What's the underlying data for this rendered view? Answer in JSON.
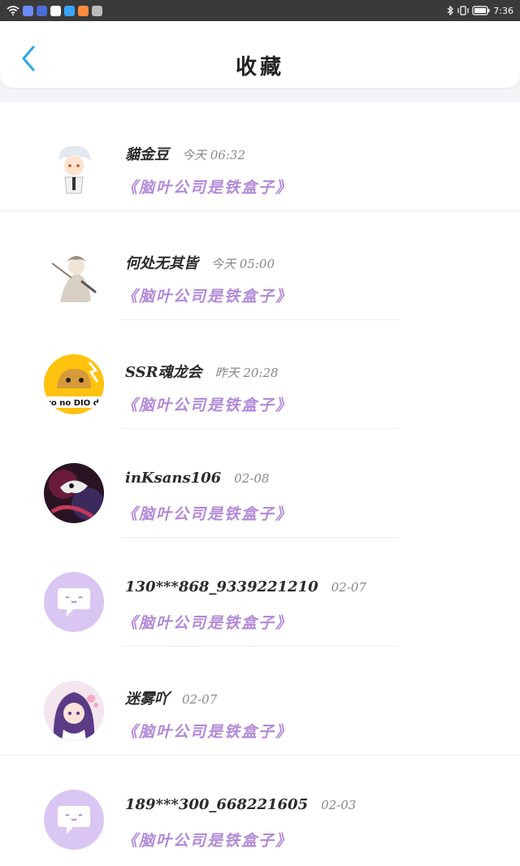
{
  "status_bar": {
    "time": "7:36",
    "app_colors": [
      "#6b8cff",
      "#4b6bd8",
      "#ffffff",
      "#3aa3ff",
      "#ff8a3d"
    ]
  },
  "header": {
    "title": "收藏",
    "back_icon": "chevron-left-icon",
    "accent": "#2aa7e8"
  },
  "favorites": [
    {
      "name": "貓金豆",
      "time": "今天 06:32",
      "ref": "《脑叶公司是铁盒子》",
      "avatar": "anime-white-hair"
    },
    {
      "name": "何处无其皆",
      "time": "今天 05:00",
      "ref": "《脑叶公司是铁盒子》",
      "avatar": "anime-sketch"
    },
    {
      "name": "SSR魂龙会",
      "time": "昨天 20:28",
      "ref": "《脑叶公司是铁盒子》",
      "avatar": "yellow-dio"
    },
    {
      "name": "inKsans106",
      "time": "02-08",
      "ref": "《脑叶公司是铁盒子》",
      "avatar": "dark-art"
    },
    {
      "name": "130***868_9339221210",
      "time": "02-07",
      "ref": "《脑叶公司是铁盒子》",
      "avatar": "default-purple"
    },
    {
      "name": "迷雾吖",
      "time": "02-07",
      "ref": "《脑叶公司是铁盒子》",
      "avatar": "anime-purple-hair"
    },
    {
      "name": "189***300_668221605",
      "time": "02-03",
      "ref": "《脑叶公司是铁盒子》",
      "avatar": "default-purple"
    }
  ],
  "colors": {
    "name": "#2b2b2b",
    "ref": "#b28ad8",
    "default_avatar_bg": "#d9c6f3"
  }
}
